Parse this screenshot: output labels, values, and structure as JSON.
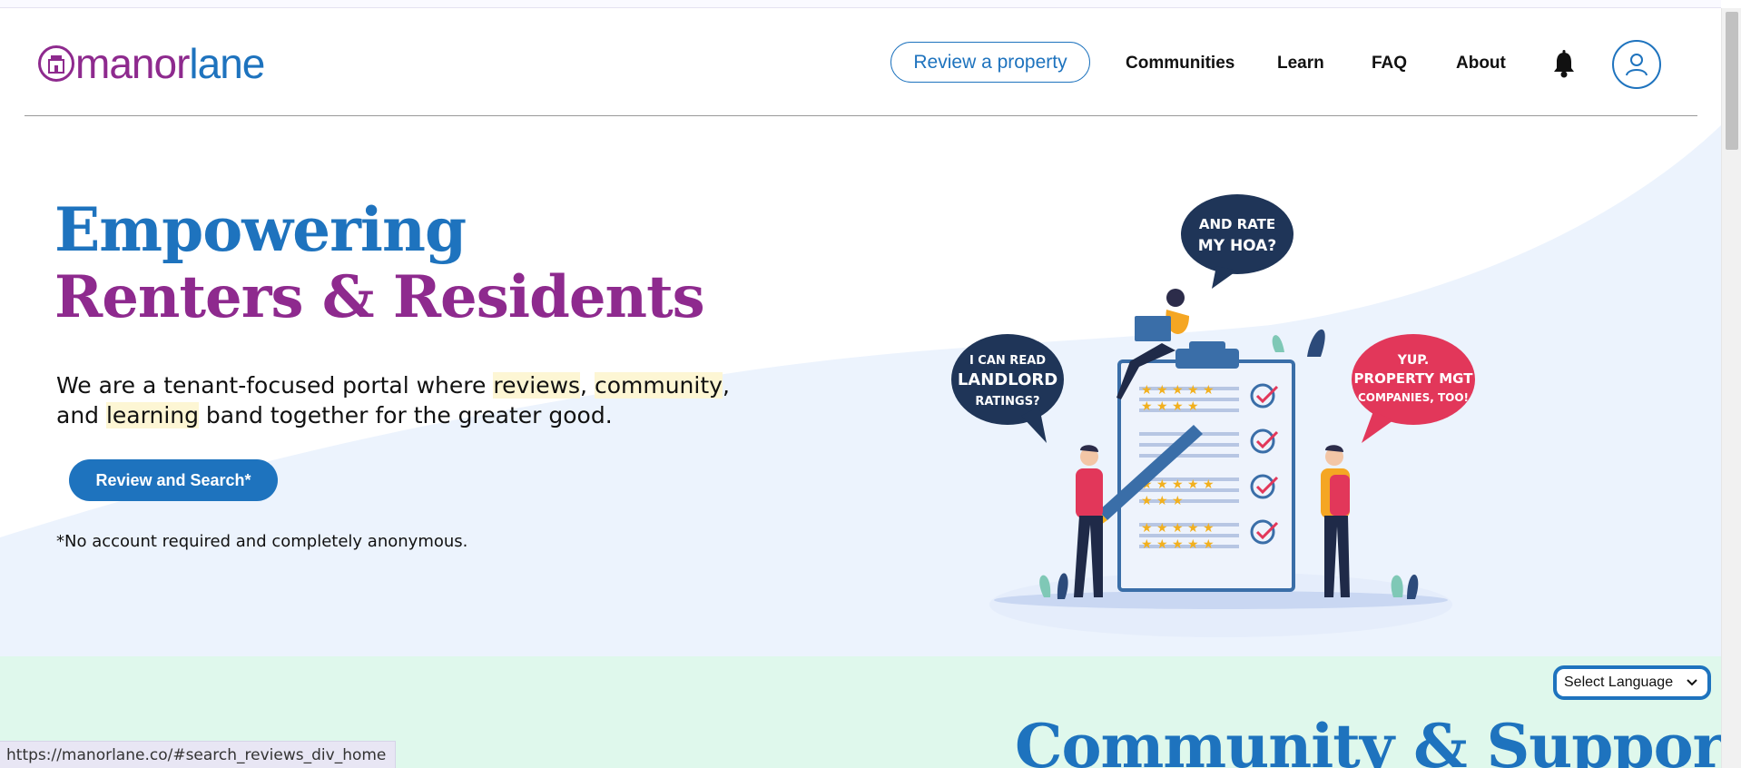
{
  "brand": {
    "name_part1": "manor",
    "name_part2": "lane",
    "colors": {
      "blue": "#1e73be",
      "purple": "#8e2a8e",
      "mint": "#dff8ec"
    }
  },
  "nav": {
    "review_button": "Review a property",
    "links": [
      "Communities",
      "Learn",
      "FAQ",
      "About"
    ],
    "icons": [
      "bell-icon",
      "user-icon"
    ]
  },
  "hero": {
    "title_line1": "Empowering",
    "title_line2": "Renters & Residents",
    "text_a": "We are a tenant-focused portal where ",
    "text_reviews": "reviews",
    "text_comma1": ", ",
    "text_community": "community",
    "text_and": ",",
    "text_and2": "and ",
    "text_learning": "learning",
    "text_rest": " band together for the greater good.",
    "cta": "Review and Search*",
    "footnote": "*No account required and completely anonymous.",
    "bubbles": {
      "left": [
        "I CAN READ",
        "LANDLORD",
        "RATINGS?"
      ],
      "top": [
        "AND RATE",
        "MY HOA?"
      ],
      "right": [
        "YUP.",
        "PROPERTY MGT",
        "COMPANIES, TOO!"
      ]
    }
  },
  "community": {
    "title": "Community & Support",
    "language_select": "Select Language"
  },
  "status_bar": {
    "url": "https://manorlane.co/#search_reviews_div_home"
  }
}
